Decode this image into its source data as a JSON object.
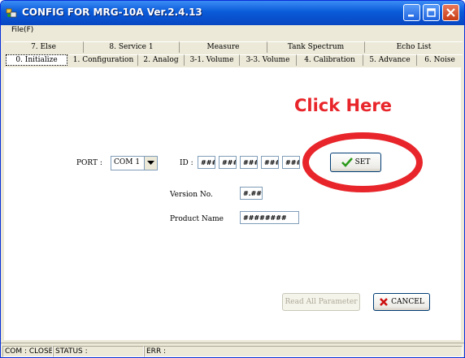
{
  "window": {
    "title": "CONFIG FOR MRG-10A Ver.2.4.13"
  },
  "menu": {
    "file_label": "File(F)"
  },
  "tabs": {
    "row1": [
      "7. Else",
      "8. Service 1",
      "Measure",
      "Tank Spectrum",
      "Echo List"
    ],
    "row2": [
      "0. Initialize",
      "1. Configuration",
      "2. Analog",
      "3-1. Volume",
      "3-3. Volume",
      "4. Calibration",
      "5. Advance",
      "6. Noise"
    ],
    "selected": "0. Initialize"
  },
  "annotation": {
    "text": "Click Here",
    "color": "#e8252a"
  },
  "form": {
    "port_label": "PORT :",
    "port_value": "COM 1",
    "id_label": "ID :",
    "id_values": [
      "###",
      "###",
      "###",
      "###",
      "###"
    ],
    "set_label": "SET",
    "version_label": "Version No.",
    "version_value": "#.##",
    "product_label": "Product Name",
    "product_value": "########"
  },
  "buttons": {
    "read_all_label": "Read All Parameter",
    "cancel_label": "CANCEL"
  },
  "status": {
    "com": "COM : CLOSE",
    "status": "STATUS :",
    "err": "ERR :"
  },
  "colors": {
    "titlebar": "#0a5bd9",
    "window_bg": "#ece9d8",
    "annotation_red": "#e8252a",
    "check_green": "#2a9a1a",
    "cancel_x_red": "#cc1010"
  }
}
